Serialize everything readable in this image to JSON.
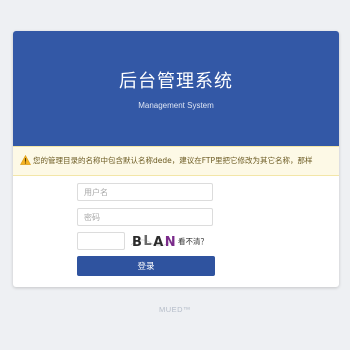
{
  "header": {
    "title": "后台管理系统",
    "subtitle": "Management System"
  },
  "warning": {
    "text": "您的管理目录的名称中包含默认名称dede，建议在FTP里把它修改为其它名称，那样"
  },
  "form": {
    "username_placeholder": "用户名",
    "password_placeholder": "密码",
    "captcha_code": "BLAN",
    "captcha_help": "看不清？",
    "login_label": "登录"
  },
  "footer": {
    "text": "MUED™"
  },
  "colors": {
    "header_bg": "#3358a6",
    "button_bg": "#2f539f",
    "warning_bg": "#fdf9e6",
    "page_bg": "#eef0f3"
  },
  "icons": [
    "warning-icon"
  ]
}
